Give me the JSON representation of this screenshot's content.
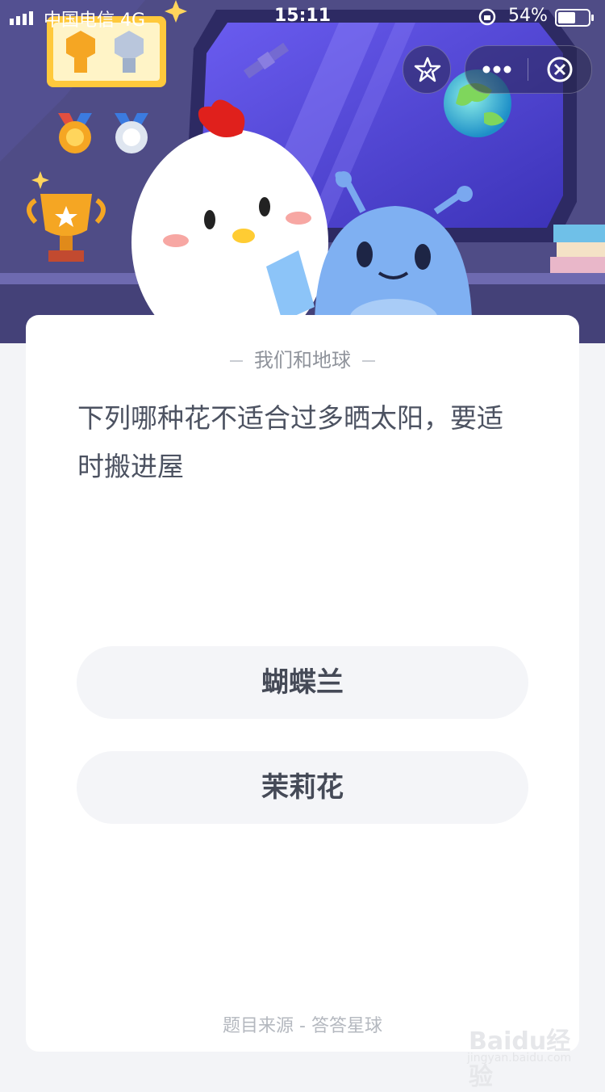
{
  "status_bar": {
    "carrier": "中国电信  4G",
    "time": "15:11",
    "battery_percent": "54%"
  },
  "nav": {
    "favorite_icon": "star-check-icon",
    "more_icon": "more-dots-icon",
    "close_icon": "close-circle-icon"
  },
  "quiz": {
    "category": "我们和地球",
    "question": "下列哪种花不适合过多晒太阳，要适时搬进屋",
    "options": [
      "蝴蝶兰",
      "茉莉花"
    ],
    "source": "题目来源 - 答答星球"
  },
  "watermark": {
    "text": "Baidu经验",
    "url": "jingyan.baidu.com"
  },
  "colors": {
    "hero_bg": "#4f4c86",
    "card_bg": "#ffffff",
    "option_bg": "#f4f5f8",
    "question_text": "#4c5261"
  }
}
